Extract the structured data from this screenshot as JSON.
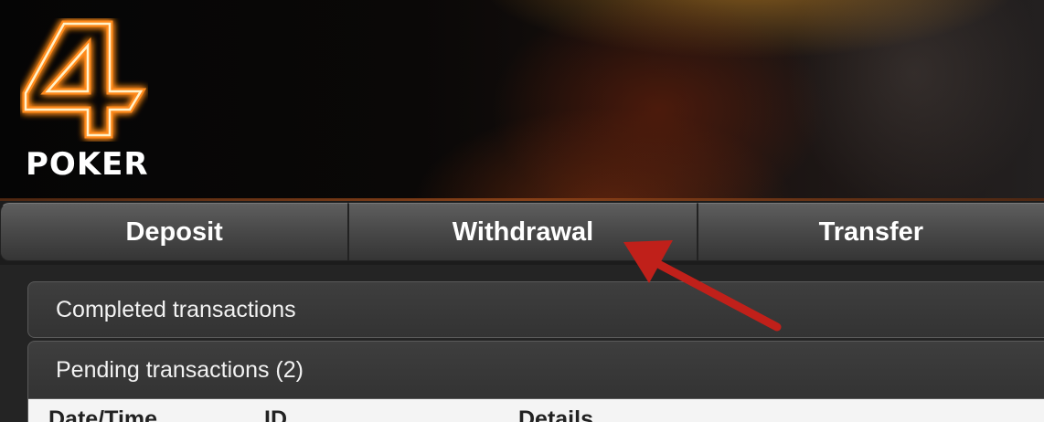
{
  "brand": {
    "logo_numeral": "4",
    "logo_word": "POKER",
    "glow_color": "#ff8a1c"
  },
  "tabs": [
    {
      "label": "Deposit"
    },
    {
      "label": "Withdrawal"
    },
    {
      "label": "Transfer"
    }
  ],
  "sections": {
    "completed_label": "Completed transactions",
    "pending_label": "Pending transactions (2)"
  },
  "table": {
    "columns": [
      "Date/Time",
      "ID",
      "Details"
    ]
  },
  "annotation": {
    "color": "#c0201a",
    "icon": "arrow-annotation"
  }
}
